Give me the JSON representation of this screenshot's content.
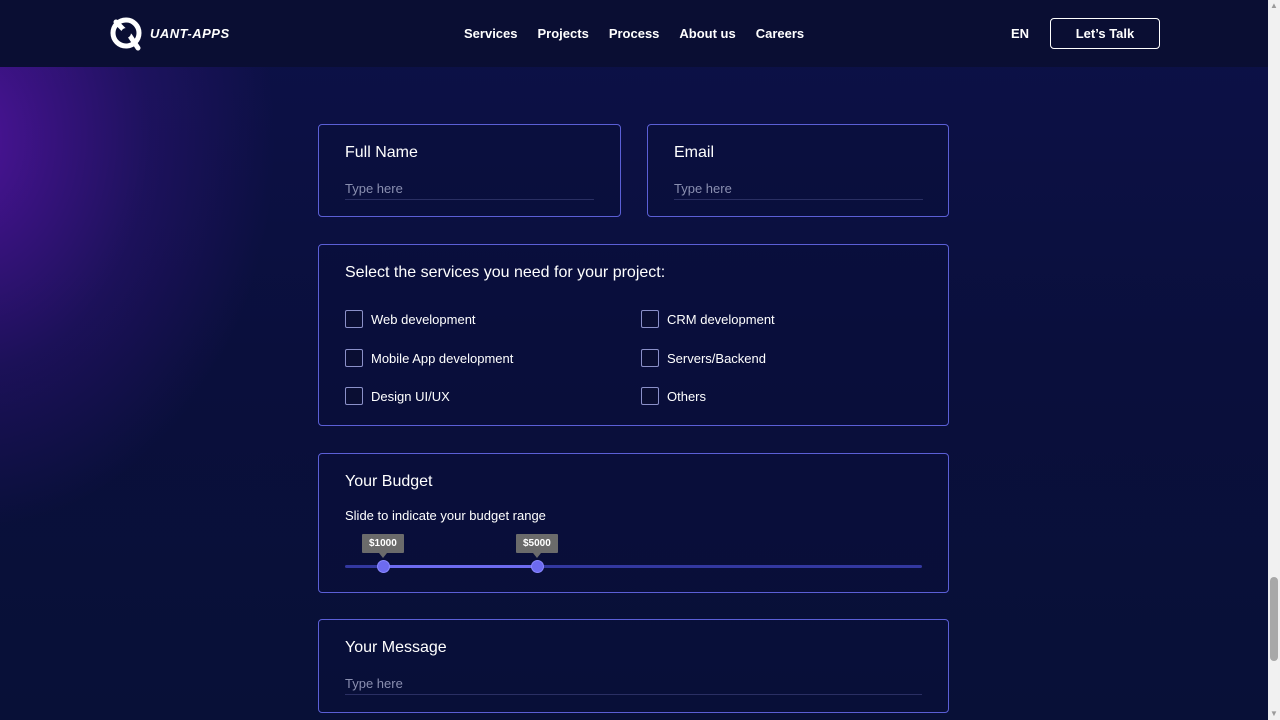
{
  "header": {
    "logo_text": "UANT-APPS",
    "nav": [
      "Services",
      "Projects",
      "Process",
      "About us",
      "Careers"
    ],
    "lang": "EN",
    "cta": "Let’s Talk"
  },
  "form": {
    "full_name": {
      "label": "Full Name",
      "placeholder": "Type here"
    },
    "email": {
      "label": "Email",
      "placeholder": "Type here"
    },
    "services": {
      "title": "Select the services you need for your project:",
      "options": [
        "Web development",
        "CRM development",
        "Mobile App development",
        "Servers/Backend",
        "Design UI/UX",
        "Others"
      ],
      "checked": []
    },
    "budget": {
      "title": "Your Budget",
      "subtitle": "Slide to indicate your budget range",
      "min_label": "$1000",
      "max_label": "$5000",
      "min_value": 1000,
      "max_value": 5000
    },
    "message": {
      "label": "Your Message",
      "placeholder": "Type here"
    }
  },
  "colors": {
    "accent": "#6d6bf0",
    "card_border": "#5b5fd6",
    "header_bg": "#0a0e33"
  }
}
